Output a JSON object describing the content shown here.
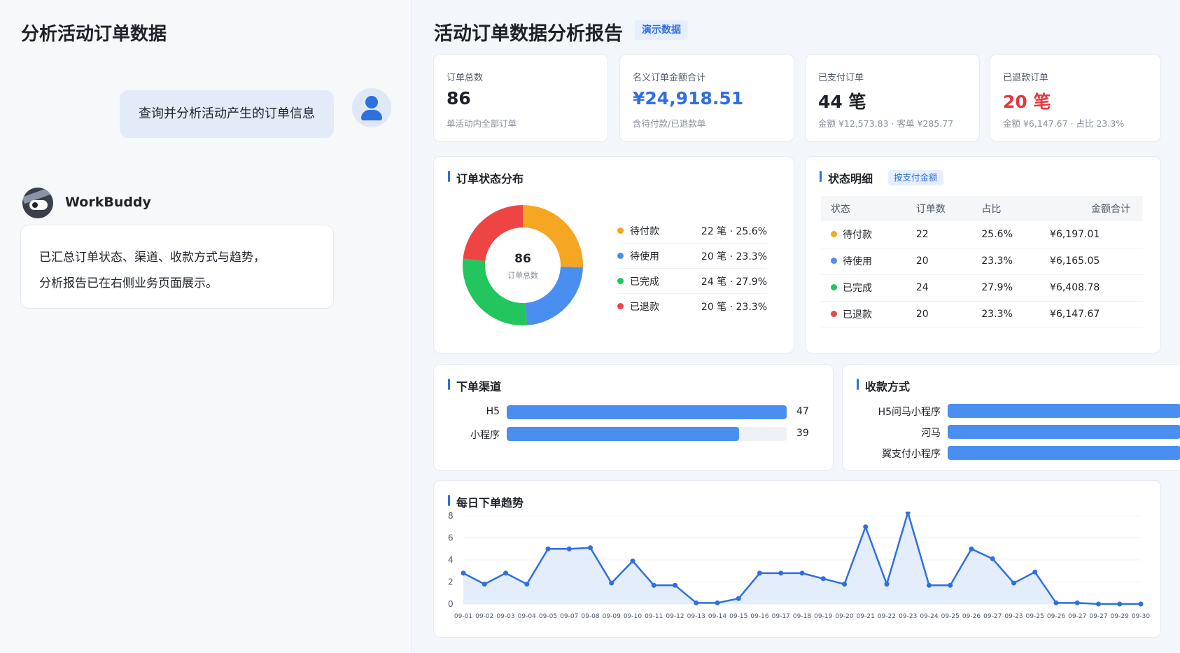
{
  "chat": {
    "title": "分析活动订单数据",
    "user_message": "查询并分析活动产生的订单信息",
    "bot_name": "WorkBuddy",
    "bot_lines": [
      "已汇总订单状态、渠道、收款方式与趋势，",
      "分析报告已在右侧业务页面展示。"
    ]
  },
  "report": {
    "title": "活动订单数据分析报告",
    "badge": "演示数据",
    "kpis": [
      {
        "label": "订单总数",
        "value": "86",
        "sub": "单活动内全部订单",
        "color": "#1f2329"
      },
      {
        "label": "名义订单金额合计",
        "value": "¥24,918.51",
        "sub": "含待付款/已退款单",
        "color": "#2f6fde"
      },
      {
        "label": "已支付订单",
        "value": "44 笔",
        "sub": "金额 ¥12,573.83 · 客单 ¥285.77",
        "color": "#1f2329"
      },
      {
        "label": "已退款订单",
        "value": "20 笔",
        "sub": "金额 ¥6,147.67 · 占比 23.3%",
        "color": "#e8363f"
      }
    ],
    "status_dist": {
      "title": "订单状态分布",
      "center_value": "86",
      "center_label": "订单总数",
      "items": [
        {
          "label": "待付款",
          "value": "22 笔 · 25.6%",
          "count": 22,
          "color": "#f5a623"
        },
        {
          "label": "待使用",
          "value": "20 笔 · 23.3%",
          "count": 20,
          "color": "#4a8ef0"
        },
        {
          "label": "已完成",
          "value": "24 笔 · 27.9%",
          "count": 24,
          "color": "#22c55e"
        },
        {
          "label": "已退款",
          "value": "20 笔 · 23.3%",
          "count": 20,
          "color": "#ef4444"
        }
      ]
    },
    "status_detail": {
      "title": "状态明细",
      "badge": "按支付金额",
      "headers": [
        "状态",
        "订单数",
        "占比",
        "金额合计"
      ],
      "rows": [
        {
          "status": "待付款",
          "count": "22",
          "pct": "25.6%",
          "amount": "¥6,197.01",
          "color": "#f5a623"
        },
        {
          "status": "待使用",
          "count": "20",
          "pct": "23.3%",
          "amount": "¥6,165.05",
          "color": "#4a8ef0"
        },
        {
          "status": "已完成",
          "count": "24",
          "pct": "27.9%",
          "amount": "¥6,408.78",
          "color": "#22c55e"
        },
        {
          "status": "已退款",
          "count": "20",
          "pct": "23.3%",
          "amount": "¥6,147.67",
          "color": "#ef4444"
        }
      ]
    },
    "channels": {
      "title": "下单渠道",
      "max": 47,
      "items": [
        {
          "label": "H5",
          "value": 47,
          "text": "47"
        },
        {
          "label": "小程序",
          "value": 39,
          "text": "39"
        }
      ]
    },
    "payment": {
      "title": "收款方式",
      "items": [
        {
          "label": "H5问马小程序"
        },
        {
          "label": "河马"
        },
        {
          "label": "翼支付小程序"
        }
      ]
    },
    "trend": {
      "title": "每日下单趋势"
    }
  },
  "chart_data": {
    "type": "area",
    "title": "每日下单趋势",
    "ylim": [
      0,
      8
    ],
    "yticks": [
      0,
      2,
      4,
      6,
      8
    ],
    "grid": true,
    "x": [
      "09-01",
      "09-02",
      "09-03",
      "09-04",
      "09-05",
      "09-07",
      "09-08",
      "09-09",
      "09-10",
      "09-11",
      "09-12",
      "09-13",
      "09-14",
      "09-15",
      "09-16",
      "09-17",
      "09-18",
      "09-19",
      "09-20",
      "09-21",
      "09-22",
      "09-23",
      "09-24",
      "09-25",
      "09-26",
      "09-27",
      "09-23",
      "09-25",
      "09-26",
      "09-27",
      "09-27",
      "09-29",
      "09-30"
    ],
    "series": [
      {
        "values": [
          2.8,
          1.8,
          2.8,
          1.8,
          5,
          5,
          5.1,
          1.9,
          3.9,
          1.7,
          1.7,
          0.1,
          0.1,
          0.5,
          2.8,
          2.8,
          2.8,
          2.3,
          1.8,
          7,
          1.8,
          8.3,
          1.7,
          1.7,
          5,
          4.1,
          1.9,
          2.9,
          0.1,
          0.1,
          0,
          0,
          0
        ],
        "color": "#2f6fde"
      }
    ]
  }
}
